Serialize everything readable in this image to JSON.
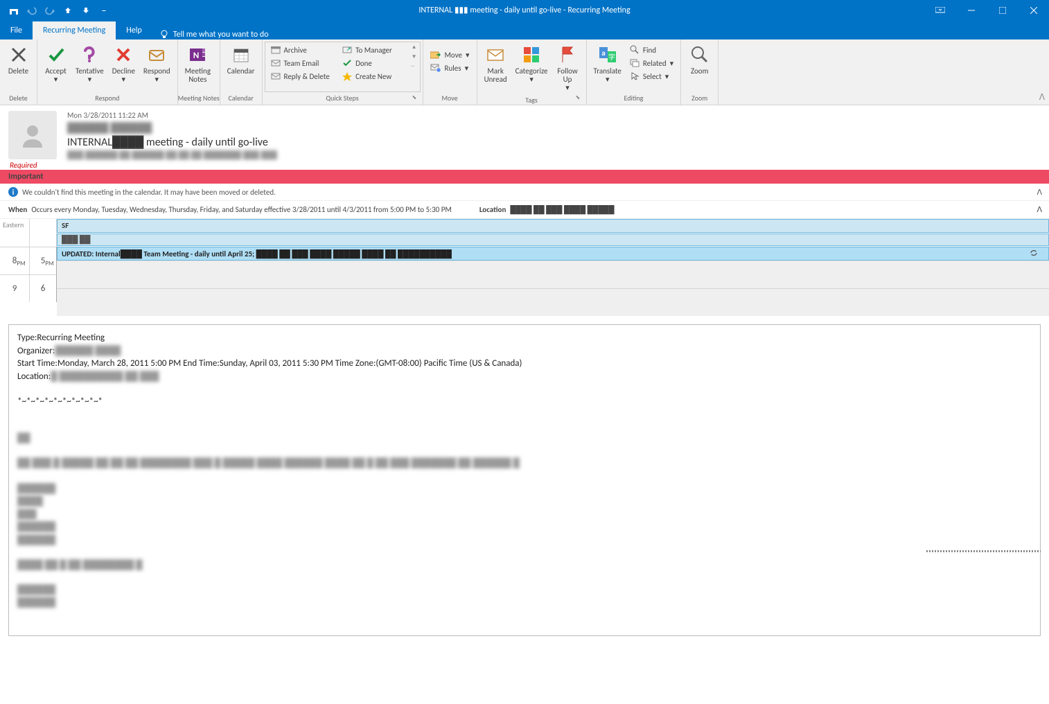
{
  "titlebar": {
    "title": "INTERNAL ▮▮▮ meeting - daily until go-live  -  Recurring Meeting"
  },
  "tabs": {
    "file": "File",
    "meeting": "Recurring Meeting",
    "help": "Help",
    "tellme": "Tell me what you want to do"
  },
  "ribbon": {
    "delete": {
      "title": "Delete",
      "btn": "Delete"
    },
    "respond": {
      "title": "Respond",
      "accept": "Accept",
      "tentative": "Tentative",
      "decline": "Decline",
      "respond": "Respond"
    },
    "notes": {
      "title": "Meeting Notes",
      "btn": "Meeting\nNotes"
    },
    "calendar": {
      "title": "Calendar",
      "btn": "Calendar"
    },
    "quicksteps": {
      "title": "Quick Steps",
      "archive": "Archive",
      "teamemail": "Team Email",
      "replydelete": "Reply & Delete",
      "tomanager": "To Manager",
      "done": "Done",
      "createnew": "Create New"
    },
    "move": {
      "title": "Move",
      "move": "Move",
      "rules": "Rules"
    },
    "tags": {
      "title": "Tags",
      "markunread": "Mark\nUnread",
      "categorize": "Categorize",
      "followup": "Follow\nUp"
    },
    "editing": {
      "title": "Editing",
      "translate": "Translate",
      "find": "Find",
      "related": "Related",
      "select": "Select"
    },
    "zoom": {
      "title": "Zoom",
      "btn": "Zoom"
    }
  },
  "header": {
    "date": "Mon 3/28/2011 11:22 AM",
    "from": "██████ ██████",
    "subject_prefix": "INTERNAL",
    "subject_suffix": " meeting - daily until go-live",
    "to": "███ ██████ ██ ██████ ██ ██ ██ ███████ ███ ███",
    "required": "Required"
  },
  "bars": {
    "important": "Important",
    "info": "We couldn't find this meeting in the calendar. It may have been moved or deleted.",
    "when_label": "When",
    "when_text": "Occurs every Monday, Tuesday, Wednesday, Thursday, Friday, and Saturday effective 3/28/2011 until 4/3/2011 from 5:00 PM to 5:30 PM",
    "location_label": "Location",
    "location_text": "████ ██ ███ ████ █████"
  },
  "calendar": {
    "tz": "Eastern",
    "hour1a": "8",
    "hour1b": "5",
    "ampm": "PM",
    "hour2a": "9",
    "hour2b": "6",
    "event1": "SF",
    "event2": "███ ██",
    "event3_pre": "UPDATED: Internal",
    "event3_suf": " Team Meeting - daily until April 25;"
  },
  "body": {
    "type_label": "Type:",
    "type_val": "Recurring Meeting",
    "org_label": "Organizer:",
    "start": "Start Time:Monday, March 28, 2011 5:00 PM End Time:Sunday, April 03, 2011 5:30 PM Time Zone:(GMT-08:00) Pacific Time (US & Canada)",
    "loc_label": "Location:",
    "divider": "*~*~*~*~*~*~*~*~*~*"
  }
}
